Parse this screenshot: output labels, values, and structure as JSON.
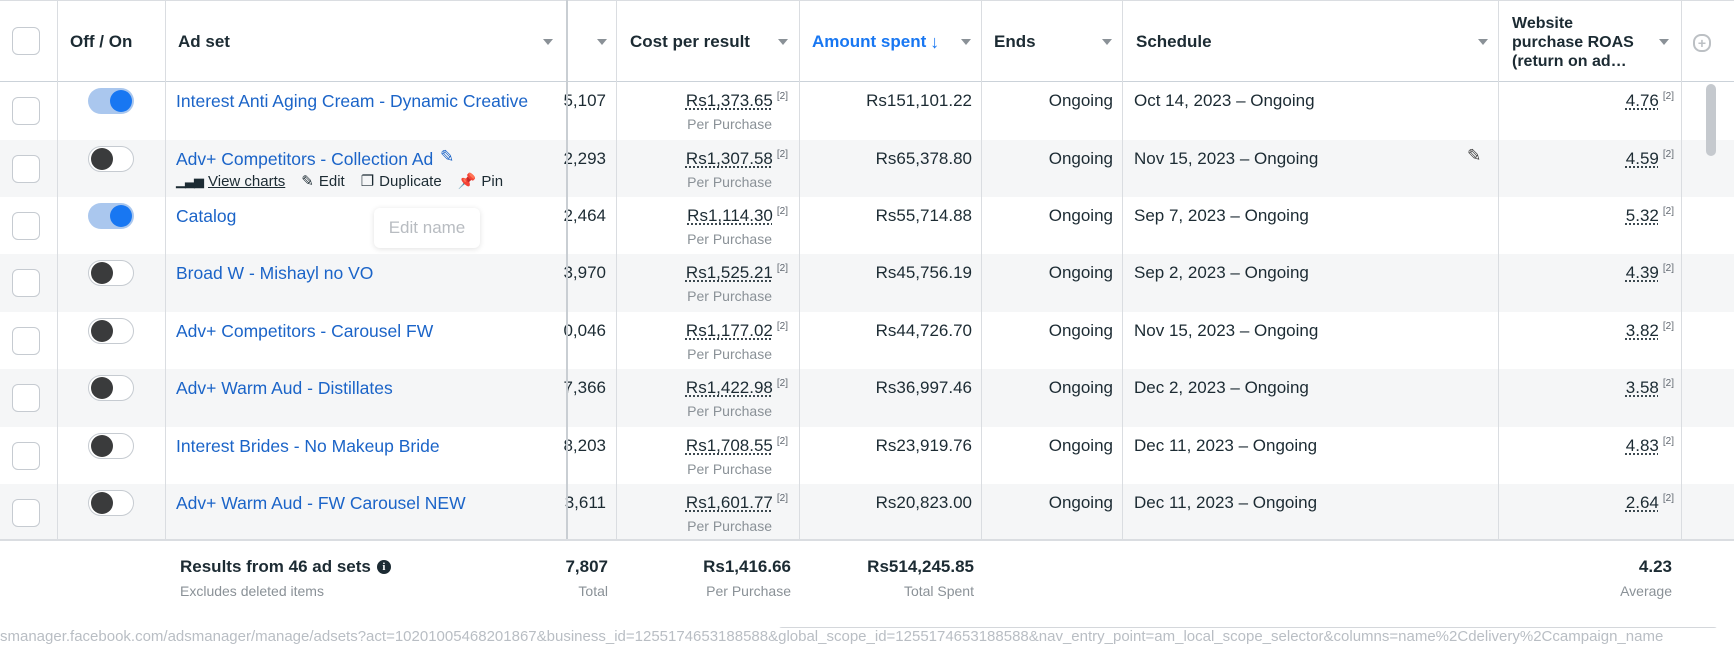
{
  "columns": {
    "off_on": "Off / On",
    "ad_set": "Ad set",
    "cost_per_result": "Cost per result",
    "amount_spent": "Amount spent",
    "ends": "Ends",
    "schedule": "Schedule",
    "roas_line1": "Website",
    "roas_line2": "purchase ROAS",
    "roas_line3": "(return on ad…"
  },
  "rows": [
    {
      "name": "Interest Anti Aging Cream - Dynamic Creative",
      "toggle": "on",
      "results": "5,107",
      "cpr": "Rs1,373.65",
      "cpr_sub": "Per Purchase",
      "spent": "Rs151,101.22",
      "ends": "Ongoing",
      "schedule": "Oct 14, 2023 – Ongoing",
      "roas": "4.76",
      "sup": "[2]"
    },
    {
      "name": "Adv+ Competitors - Collection Ad",
      "toggle": "off",
      "results": "2,293",
      "cpr": "Rs1,307.58",
      "cpr_sub": "Per Purchase",
      "spent": "Rs65,378.80",
      "ends": "Ongoing",
      "schedule": "Nov 15, 2023 – Ongoing",
      "roas": "4.59",
      "sup": "[2]"
    },
    {
      "name": "Catalog",
      "toggle": "on",
      "results": "2,464",
      "cpr": "Rs1,114.30",
      "cpr_sub": "Per Purchase",
      "spent": "Rs55,714.88",
      "ends": "Ongoing",
      "schedule": "Sep 7, 2023 – Ongoing",
      "roas": "5.32",
      "sup": "[2]"
    },
    {
      "name": "Broad W - Mishayl no VO",
      "toggle": "off",
      "results": "3,970",
      "cpr": "Rs1,525.21",
      "cpr_sub": "Per Purchase",
      "spent": "Rs45,756.19",
      "ends": "Ongoing",
      "schedule": "Sep 2, 2023 – Ongoing",
      "roas": "4.39",
      "sup": "[2]"
    },
    {
      "name": "Adv+ Competitors - Carousel FW",
      "toggle": "off",
      "results": "0,046",
      "cpr": "Rs1,177.02",
      "cpr_sub": "Per Purchase",
      "spent": "Rs44,726.70",
      "ends": "Ongoing",
      "schedule": "Nov 15, 2023 – Ongoing",
      "roas": "3.82",
      "sup": "[2]"
    },
    {
      "name": "Adv+ Warm Aud - Distillates",
      "toggle": "off",
      "results": "7,366",
      "cpr": "Rs1,422.98",
      "cpr_sub": "Per Purchase",
      "spent": "Rs36,997.46",
      "ends": "Ongoing",
      "schedule": "Dec 2, 2023 – Ongoing",
      "roas": "3.58",
      "sup": "[2]"
    },
    {
      "name": "Interest Brides - No Makeup Bride",
      "toggle": "off",
      "results": "8,203",
      "cpr": "Rs1,708.55",
      "cpr_sub": "Per Purchase",
      "spent": "Rs23,919.76",
      "ends": "Ongoing",
      "schedule": "Dec 11, 2023 – Ongoing",
      "roas": "4.83",
      "sup": "[2]"
    },
    {
      "name": "Adv+ Warm Aud - FW Carousel NEW",
      "toggle": "off",
      "results": "3,611",
      "cpr": "Rs1,601.77",
      "cpr_sub": "Per Purchase",
      "spent": "Rs20,823.00",
      "ends": "Ongoing",
      "schedule": "Dec 11, 2023 – Ongoing",
      "roas": "2.64",
      "sup": "[2]"
    }
  ],
  "row_actions": {
    "view_charts": "View charts",
    "edit": "Edit",
    "duplicate": "Duplicate",
    "pin": "Pin"
  },
  "tooltip": "Edit name",
  "footer": {
    "title": "Results from 46 ad sets",
    "subtitle": "Excludes deleted items",
    "results": "7,807",
    "results_sub": "Total",
    "cpr": "Rs1,416.66",
    "cpr_sub": "Per Purchase",
    "spent": "Rs514,245.85",
    "spent_sub": "Total Spent",
    "roas": "4.23",
    "roas_sub": "Average"
  },
  "status_url": "smanager.facebook.com/adsmanager/manage/adsets?act=10201005468201867&business_id=1255174653188588&global_scope_id=1255174653188588&nav_entry_point=am_local_scope_selector&columns=name%2Cdelivery%2Ccampaign_name",
  "colors": {
    "link": "#1b64c8",
    "accent": "#1877f2",
    "toggle_on_track": "#aac7ee"
  }
}
